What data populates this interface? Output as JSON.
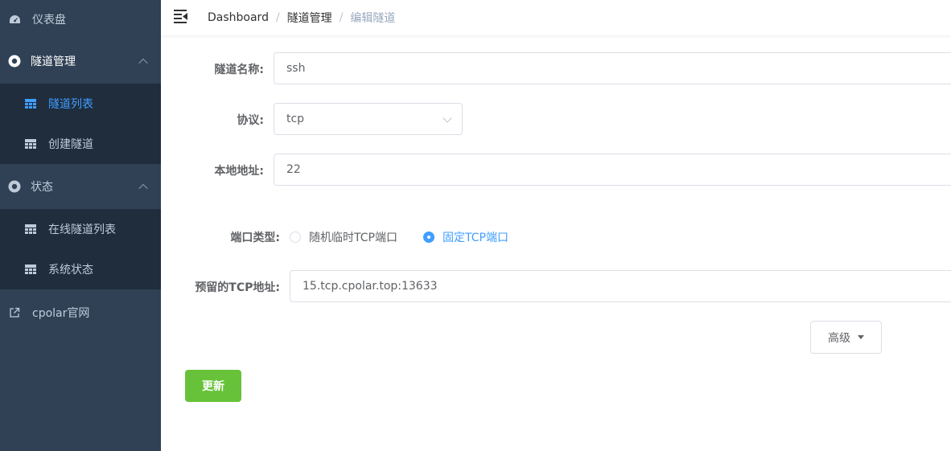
{
  "sidebar": {
    "dashboard": "仪表盘",
    "tunnel_mgmt": {
      "label": "隧道管理",
      "items": [
        {
          "label": "隧道列表",
          "active": true
        },
        {
          "label": "创建隧道",
          "active": false
        }
      ]
    },
    "status": {
      "label": "状态",
      "items": [
        {
          "label": "在线隧道列表"
        },
        {
          "label": "系统状态"
        }
      ]
    },
    "external_link": "cpolar官网"
  },
  "breadcrumb": [
    "Dashboard",
    "隧道管理",
    "编辑隧道"
  ],
  "breadcrumb_separator": "/",
  "form": {
    "name": {
      "label": "隧道名称:",
      "value": "ssh"
    },
    "protocol": {
      "label": "协议:",
      "value": "tcp"
    },
    "local_address": {
      "label": "本地地址:",
      "value": "22"
    },
    "port_type": {
      "label": "端口类型:",
      "options": [
        "随机临时TCP端口",
        "固定TCP端口"
      ],
      "selected": "固定TCP端口"
    },
    "reserved_address": {
      "label": "预留的TCP地址:",
      "value": "15.tcp.cpolar.top:13633"
    },
    "advanced_label": "高级",
    "submit_label": "更新"
  },
  "colors": {
    "sidebar_bg": "#304156",
    "submenu_bg": "#1f2d3d",
    "active": "#409eff",
    "success": "#67c23a"
  }
}
